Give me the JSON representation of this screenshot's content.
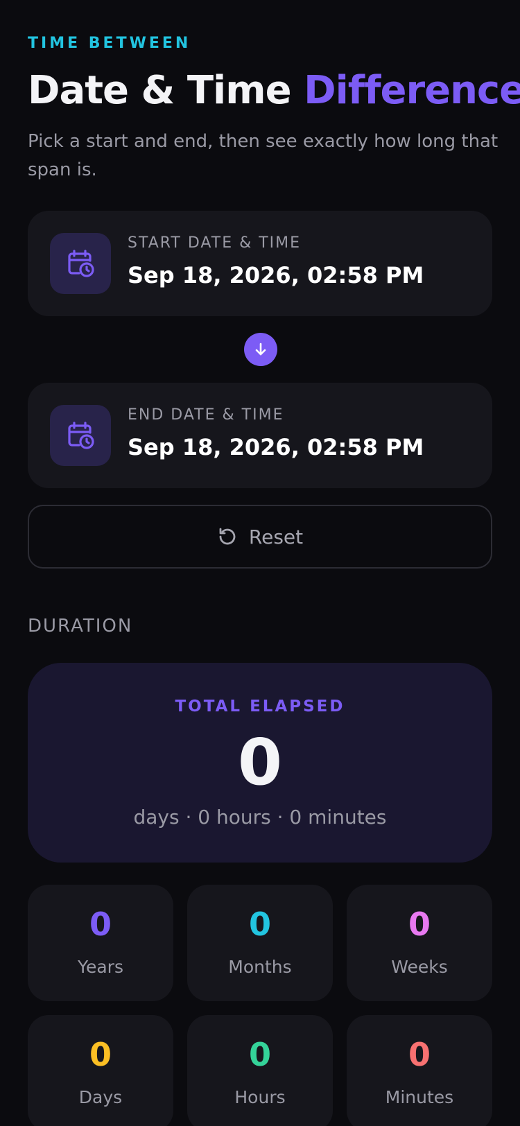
{
  "header": {
    "eyebrow": "TIME BETWEEN",
    "title_main": "Date & Time ",
    "title_accent": "Difference",
    "subtitle": "Pick a start and end, then see exactly how long that span is."
  },
  "start": {
    "label": "START DATE & TIME",
    "value": "Sep 18, 2026, 02:58 PM",
    "icon": "calendar-clock-icon"
  },
  "end": {
    "label": "END DATE & TIME",
    "value": "Sep 18, 2026, 02:58 PM",
    "icon": "calendar-clock-icon"
  },
  "swap": {
    "icon": "arrow-down-icon"
  },
  "reset": {
    "label": "Reset",
    "icon": "reset-icon"
  },
  "duration": {
    "section_label": "DURATION",
    "total_label": "TOTAL ELAPSED",
    "total_value": "0",
    "total_detail": "days · 0 hours · 0 minutes"
  },
  "stats": [
    {
      "value": "0",
      "label": "Years",
      "color": "#7c5cf5"
    },
    {
      "value": "0",
      "label": "Months",
      "color": "#22c4e0"
    },
    {
      "value": "0",
      "label": "Weeks",
      "color": "#e879f0"
    },
    {
      "value": "0",
      "label": "Days",
      "color": "#fbbf24"
    },
    {
      "value": "0",
      "label": "Hours",
      "color": "#34d399"
    },
    {
      "value": "0",
      "label": "Minutes",
      "color": "#f87171"
    }
  ],
  "colors": {
    "accent": "#7c5cf5",
    "eyebrow": "#22c4e0",
    "background": "#0b0b0f",
    "card": "#16161c"
  }
}
